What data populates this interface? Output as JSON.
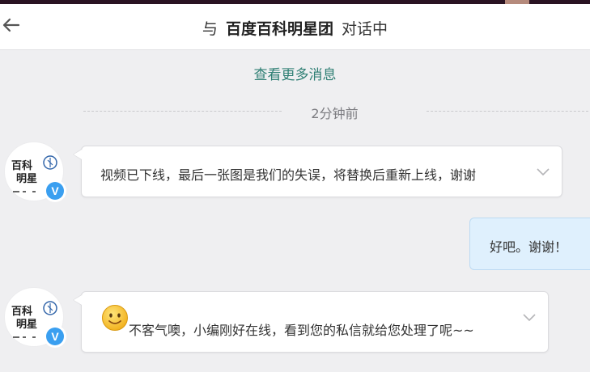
{
  "header": {
    "title_prefix": "与",
    "contact_name": "百度百科明星团",
    "title_suffix": "对话中"
  },
  "more_messages_label": "查看更多消息",
  "time_separator": "2分钟前",
  "messages": [
    {
      "direction": "incoming",
      "text": "视频已下线，最后一张图是我们的失误，将替换后重新上线，谢谢",
      "avatar_text": [
        "百科",
        "明星"
      ],
      "badge": "V"
    },
    {
      "direction": "outgoing",
      "text": "好吧。谢谢！"
    },
    {
      "direction": "incoming",
      "text": "不客气噢，小编刚好在线，看到您的私信就给您处理了呢~~",
      "emoji": "smile-emoji",
      "avatar_text": [
        "百科",
        "明星"
      ],
      "badge": "V"
    }
  ],
  "colors": {
    "link": "#2f7f74",
    "outgoing_bubble": "#dff0fd",
    "verified_badge": "#3a9ff0"
  }
}
